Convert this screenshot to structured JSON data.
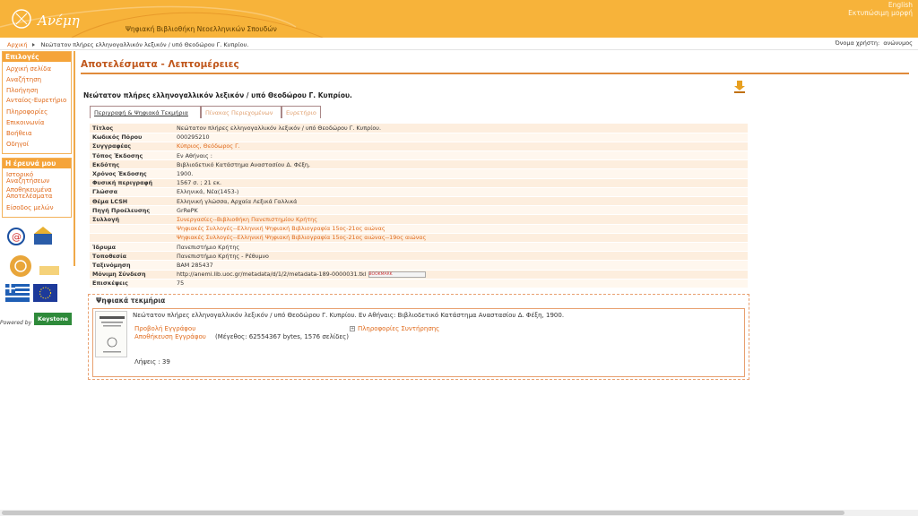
{
  "header": {
    "logo_text": "Ανέμη",
    "site_title": "Ψηφιακή Βιβλιοθήκη Νεοελληνικών Σπουδών",
    "links": [
      "English",
      "Εκτυπώσιμη μορφή"
    ]
  },
  "breadcrumb": {
    "home": "Αρχική",
    "current": "Νεώτατον πλήρες ελληνογαλλικόν λεξικόν / υπό Θεοδώρου Γ. Κυπρίου."
  },
  "user": {
    "label": "Όνομα χρήστη:",
    "value": "ανώνυμος"
  },
  "sidebar": {
    "options_title": "Επιλογές",
    "options": [
      "Αρχική σελίδα",
      "Αναζήτηση",
      "Πλοήγηση",
      "Ανταίος-Ευρετήριο",
      "Πληροφορίες",
      "Επικοινωνία",
      "Βοήθεια",
      "Οδηγοί"
    ],
    "research_title": "Η έρευνά μου",
    "research": [
      "Ιστορικό Αναζητήσεων",
      "Αποθηκευμένα Αποτελέσματα",
      "Είσοδος μελών"
    ],
    "powered_by": "Powered by",
    "keystone": "Keystone"
  },
  "main": {
    "page_title": "Αποτελέσματα - Λεπτομέρειες",
    "record_title": "Νεώτατον πλήρες ελληνογαλλικόν λεξικόν / υπό Θεοδώρου Γ. Κυπρίου.",
    "tabs": [
      "Περιγραφή & Ψηφιακά Τεκμήρια",
      "Πίνακας Περιεχομένων",
      "Ευρετήριο"
    ],
    "fields": [
      {
        "label": "Τίτλος",
        "value": "Νεώτατον πλήρες ελληνογαλλικόν λεξικόν / υπό Θεοδώρου Γ. Κυπρίου.",
        "link": false
      },
      {
        "label": "Κωδικός Πόρου",
        "value": "000295210",
        "link": false
      },
      {
        "label": "Συγγραφέας",
        "value": "Κύπριος, Θεόδωρος Γ.",
        "link": true
      },
      {
        "label": "Τόπος Έκδοσης",
        "value": "Εν Αθήναις :",
        "link": false
      },
      {
        "label": "Εκδότης",
        "value": "Βιβλιοδετικό Κατάστημα Αναστασίου Δ. Φέξη,",
        "link": false
      },
      {
        "label": "Χρόνος Έκδοσης",
        "value": "1900.",
        "link": false
      },
      {
        "label": "Φυσική περιγραφή",
        "value": "1567 σ. ; 21 εκ.",
        "link": false
      },
      {
        "label": "Γλώσσα",
        "value": "Ελληνικά, Νέα(1453-)",
        "link": false
      },
      {
        "label": "Θέμα LCSH",
        "value": "Ελληνική γλώσσα, Αρχαία Λεξικά Γαλλικά",
        "link": false
      },
      {
        "label": "Πηγή Προέλευσης",
        "value": "GrRePK",
        "link": false
      },
      {
        "label": "Συλλογή",
        "value": "Συνεργασίες--Βιβλιοθήκη Πανεπιστημίου Κρήτης",
        "link": true
      },
      {
        "label": "",
        "value": "Ψηφιακές Συλλογές--Ελληνική Ψηφιακή Βιβλιογραφία 15ος-21ος αιώνας",
        "link": true
      },
      {
        "label": "",
        "value": "Ψηφιακές Συλλογές--Ελληνική Ψηφιακή Βιβλιογραφία 15ος-21ος αιώνας--19ος αιώνας",
        "link": true
      },
      {
        "label": "Ίδρυμα",
        "value": "Πανεπιστήμιο Κρήτης",
        "link": false
      },
      {
        "label": "Τοποθεσία",
        "value": "Πανεπιστήμιο Κρήτης - Ρέθυμνο",
        "link": false
      },
      {
        "label": "Ταξινόμηση",
        "value": "BAM 285437",
        "link": false
      },
      {
        "label": "Μόνιμη Σύνδεση",
        "value": "http://anemi.lib.uoc.gr/metadata/d/1/2/metadata-189-0000031.tkl",
        "link": false,
        "bookmark": "BOOKMARK"
      },
      {
        "label": "Επισκέψεις",
        "value": "75",
        "link": false
      }
    ],
    "digital": {
      "title": "Ψηφιακά τεκμήρια",
      "description": "Νεώτατον πλήρες ελληνογαλλικόν λεξικόν / υπό Θεοδώρου Γ. Κυπρίου. Εν Αθήναις: Βιβλιοδετικό Κατάστημα Αναστασίου Δ. Φέξη, 1900.",
      "view": "Προβολή Εγγράφου",
      "download": "Αποθήκευση Εγγράφου",
      "size": "(Μέγεθος: 62554367 bytes, 1576 σελίδες)",
      "preservation": "Πληροφορίες Συντήρησης",
      "hits": "Λήψεις : 39"
    }
  }
}
